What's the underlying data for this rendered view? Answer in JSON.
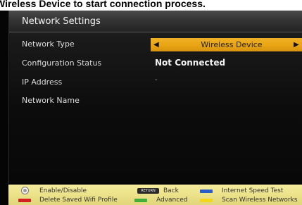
{
  "caption": "Wireless Device to start connection process.",
  "window": {
    "title": "Network Settings"
  },
  "rows": [
    {
      "label": "Network Type",
      "value": "Wireless Device"
    },
    {
      "label": "Configuration Status",
      "value": "Not Connected"
    },
    {
      "label": "IP Address",
      "value": "-"
    },
    {
      "label": "Network Name",
      "value": ""
    }
  ],
  "selector": {
    "left_arrow": "◀",
    "right_arrow": "▶"
  },
  "footer": {
    "ok_label": "Enable/Disable",
    "back_key": "RETURN",
    "back_label": "Back",
    "blue_label": "Internet Speed Test",
    "red_label": "Delete Saved Wifi Profile",
    "green_label": "Advanced",
    "yellow_label": "Scan Wireless Networks"
  },
  "colors": {
    "accent_orange": "#e8a412",
    "footer_yellow": "#ece28a",
    "key_red": "#d21f1f",
    "key_green": "#3fae3a",
    "key_blue": "#2a5cc7",
    "key_yellow": "#f3d51a"
  },
  "icons": [
    "ok-button-icon",
    "return-key-icon",
    "red-key-icon",
    "green-key-icon",
    "blue-key-icon",
    "yellow-key-icon",
    "arrow-left-icon",
    "arrow-right-icon"
  ]
}
